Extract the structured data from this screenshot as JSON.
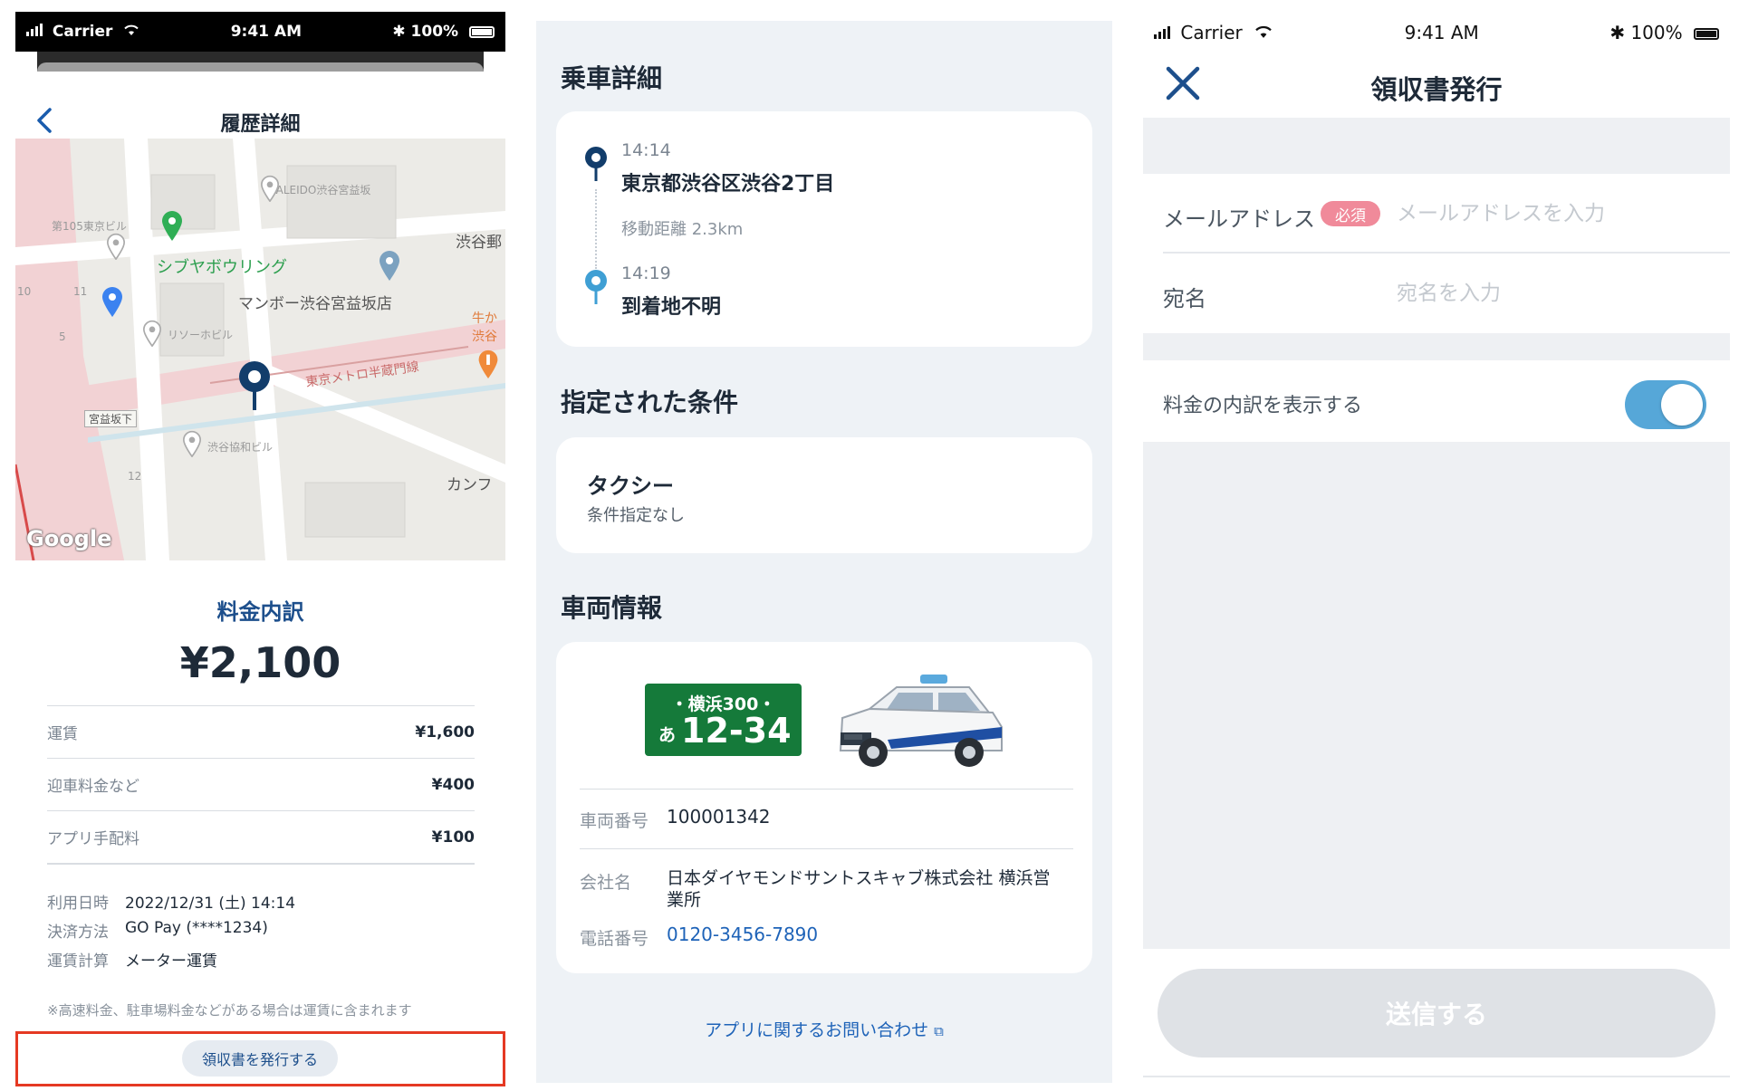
{
  "status_bar": {
    "carrier": "Carrier",
    "time": "9:41 AM",
    "battery": "100%"
  },
  "history": {
    "title": "履歴詳細",
    "map": {
      "labels": {
        "kaleido": "KALEIDO渋谷宮益坂",
        "no105": "第105東京ビル",
        "bowling": "シブヤボウリング",
        "post": "渋谷郵",
        "mambo": "マンボー渋谷宮益坂店",
        "risomi": "リソーホビル",
        "metro": "東京メトロ半蔵門線",
        "gyukatsu": "牛か渋谷",
        "miyamasu": "宮益坂下",
        "kyowa": "渋谷協和ビル",
        "kanfu": "カンフ",
        "google": "Google",
        "n10": "10",
        "n11": "11",
        "n5": "5",
        "n12": "12"
      }
    },
    "fee_title": "料金内訳",
    "fee_total": "¥2,100",
    "breakdown": [
      {
        "label": "運賃",
        "value": "¥1,600"
      },
      {
        "label": "迎車料金など",
        "value": "¥400"
      },
      {
        "label": "アプリ手配料",
        "value": "¥100"
      }
    ],
    "meta": [
      {
        "label": "利用日時",
        "value": "2022/12/31 (土) 14:14"
      },
      {
        "label": "決済方法",
        "value": "GO Pay (****1234)"
      },
      {
        "label": "運賃計算",
        "value": "メーター運賃"
      }
    ],
    "note": "※高速料金、駐車場料金などがある場合は運賃に含まれます",
    "receipt_button": "領収書を発行する"
  },
  "ride_detail": {
    "title": "乗車詳細",
    "pickup": {
      "time": "14:14",
      "place": "東京都渋谷区渋谷2丁目"
    },
    "distance": "移動距離 2.3km",
    "dropoff": {
      "time": "14:19",
      "place": "到着地不明"
    },
    "conditions_title": "指定された条件",
    "condition": {
      "title": "タクシー",
      "sub": "条件指定なし"
    },
    "vehicle_title": "車両情報",
    "plate": {
      "top": "・横浜300・",
      "hiragana": "あ",
      "number": "12-34"
    },
    "vehicle_rows": [
      {
        "label": "車両番号",
        "value": "100001342"
      },
      {
        "label": "会社名",
        "value": "日本ダイヤモンドサントスキャブ株式会社 横浜営業所"
      },
      {
        "label": "電話番号",
        "value": "0120-3456-7890"
      }
    ],
    "inquiry": "アプリに関するお問い合わせ"
  },
  "receipt": {
    "title": "領収書発行",
    "email_label": "メールアドレス",
    "required_badge": "必須",
    "email_placeholder": "メールアドレスを入力",
    "name_label": "宛名",
    "name_placeholder": "宛名を入力",
    "toggle_label": "料金の内訳を表示する",
    "toggle_on": true,
    "send_button": "送信する"
  },
  "colors": {
    "brand_navy": "#1d4f8c",
    "link_blue": "#1e63b8",
    "toggle_on": "#56a7d8",
    "plate_green": "#157a3a",
    "highlight_red": "#e53923",
    "required_pink": "#f08a9a"
  },
  "icons": [
    "signal-icon",
    "wifi-icon",
    "bluetooth-icon",
    "battery-icon",
    "back-chevron-icon",
    "close-icon",
    "pickup-pin-icon",
    "dropoff-pin-icon",
    "taxi-icon",
    "external-link-icon",
    "map-pin-icon"
  ]
}
